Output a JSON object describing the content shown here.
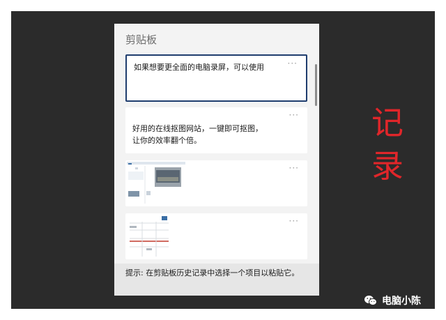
{
  "panel": {
    "title": "剪贴板",
    "more_label": "···",
    "footer_hint": "提示: 在剪贴板历史记录中选择一个项目以粘贴它。"
  },
  "items": [
    {
      "type": "text",
      "lines": [
        "如果想要更全面的电脑录屏，可以使用"
      ],
      "selected": true
    },
    {
      "type": "text",
      "lines": [
        "好用的在线抠图网站，一键即可抠图，",
        "让你的效率翻个倍。"
      ],
      "selected": false
    },
    {
      "type": "image",
      "selected": false
    },
    {
      "type": "image",
      "selected": false
    }
  ],
  "annotation": {
    "chars": [
      "记",
      "录"
    ],
    "color": "#e0262a"
  },
  "watermark": {
    "text": "电脑小陈",
    "icon": "wechat-icon"
  }
}
